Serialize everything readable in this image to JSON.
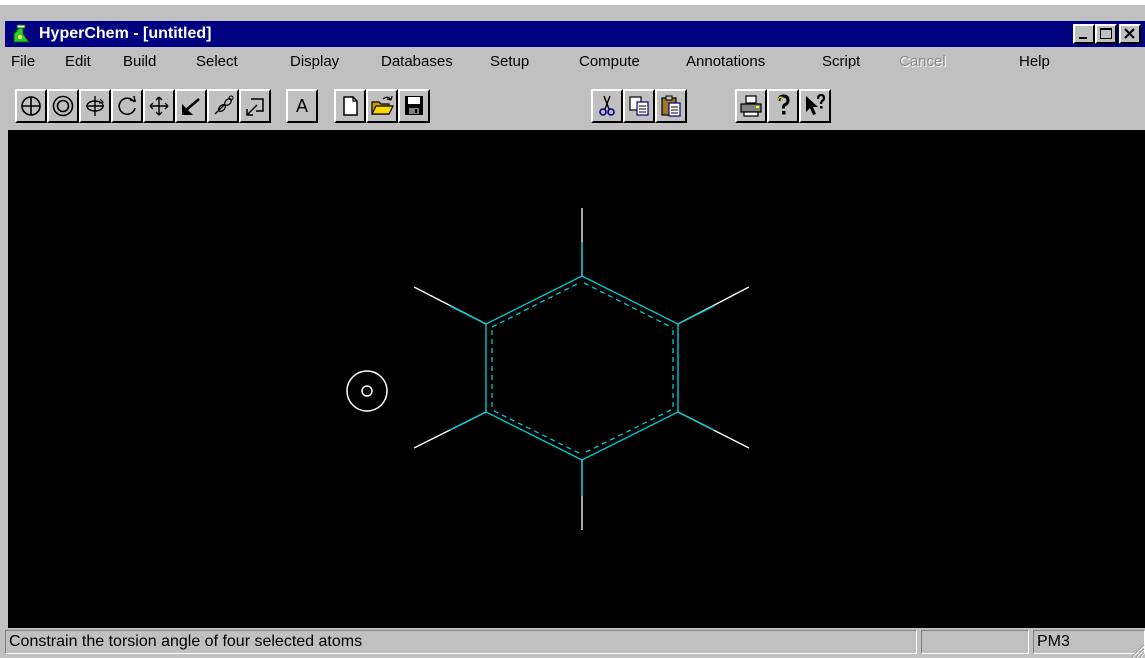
{
  "window": {
    "title": "HyperChem - [untitled]",
    "controls": [
      "minimize",
      "maximize",
      "close"
    ]
  },
  "menu": [
    {
      "label": "File",
      "enabled": true
    },
    {
      "label": "Edit",
      "enabled": true
    },
    {
      "label": "Build",
      "enabled": true
    },
    {
      "label": "Select",
      "enabled": true
    },
    {
      "label": "Display",
      "enabled": true
    },
    {
      "label": "Databases",
      "enabled": true
    },
    {
      "label": "Setup",
      "enabled": true
    },
    {
      "label": "Compute",
      "enabled": true
    },
    {
      "label": "Annotations",
      "enabled": true
    },
    {
      "label": "Script",
      "enabled": true
    },
    {
      "label": "Cancel",
      "enabled": false
    },
    {
      "label": "Help",
      "enabled": true
    }
  ],
  "toolbar": {
    "text_tool_label": "A",
    "tools": [
      "select-tool",
      "draw-tool",
      "rotate-out-of-plane",
      "rotate-in-plane",
      "translate",
      "z-translate",
      "magnify",
      "z-clip",
      "text-annotation",
      "new",
      "open",
      "save",
      "cut",
      "copy",
      "paste",
      "print",
      "help",
      "context-help"
    ]
  },
  "workspace": {
    "background": "#000000",
    "molecule": "benzene",
    "ring_bond_color": "#00c8d2",
    "hydrogen_bond_color": "#ffffff"
  },
  "status": {
    "message": "Constrain the torsion angle of four selected atoms",
    "middle": "",
    "method": "PM3"
  }
}
